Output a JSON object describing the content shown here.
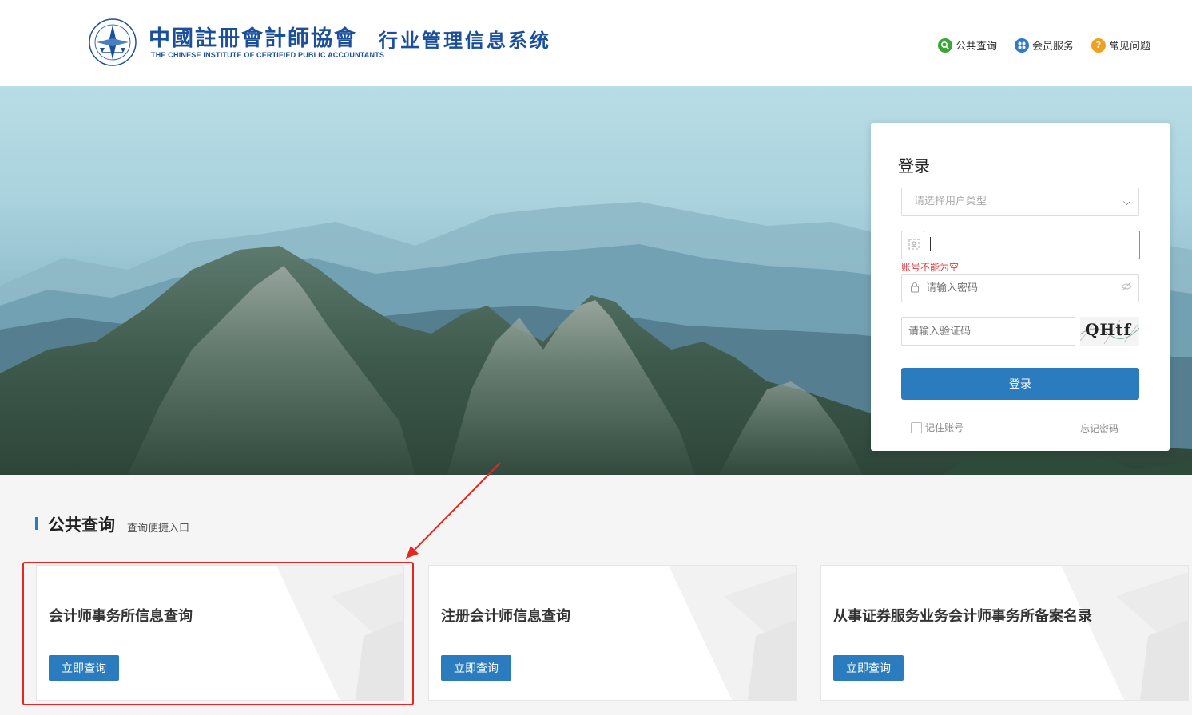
{
  "header": {
    "logo_cn": "中國註冊會計師協會",
    "logo_en": "THE CHINESE INSTITUTE OF CERTIFIED PUBLIC ACCOUNTANTS",
    "system_title": "行业管理信息系统",
    "nav": [
      {
        "label": "公共查询",
        "icon": "search-icon",
        "color": "#3aa635"
      },
      {
        "label": "会员服务",
        "icon": "member-icon",
        "color": "#2f7ad0"
      },
      {
        "label": "常见问题",
        "icon": "question-icon",
        "color": "#f0a020"
      }
    ]
  },
  "login": {
    "title": "登录",
    "user_type_placeholder": "请选择用户类型",
    "account_value": "",
    "account_error": "账号不能为空",
    "password_placeholder": "请输入密码",
    "captcha_placeholder": "请输入验证码",
    "captcha_text": "QHtf",
    "submit_label": "登录",
    "remember_label": "记住账号",
    "forgot_label": "忘记密码"
  },
  "public_query": {
    "title": "公共查询",
    "subtitle": "查询便捷入口",
    "cards": [
      {
        "title": "会计师事务所信息查询",
        "button": "立即查询"
      },
      {
        "title": "注册会计师信息查询",
        "button": "立即查询"
      },
      {
        "title": "从事证券服务业务会计师事务所备案名录",
        "button": "立即查询"
      }
    ]
  },
  "colors": {
    "brand_blue": "#1b4f9c",
    "button_blue": "#2b7cbf",
    "error_red": "#e43b3b",
    "annotation_red": "#e8261f"
  }
}
